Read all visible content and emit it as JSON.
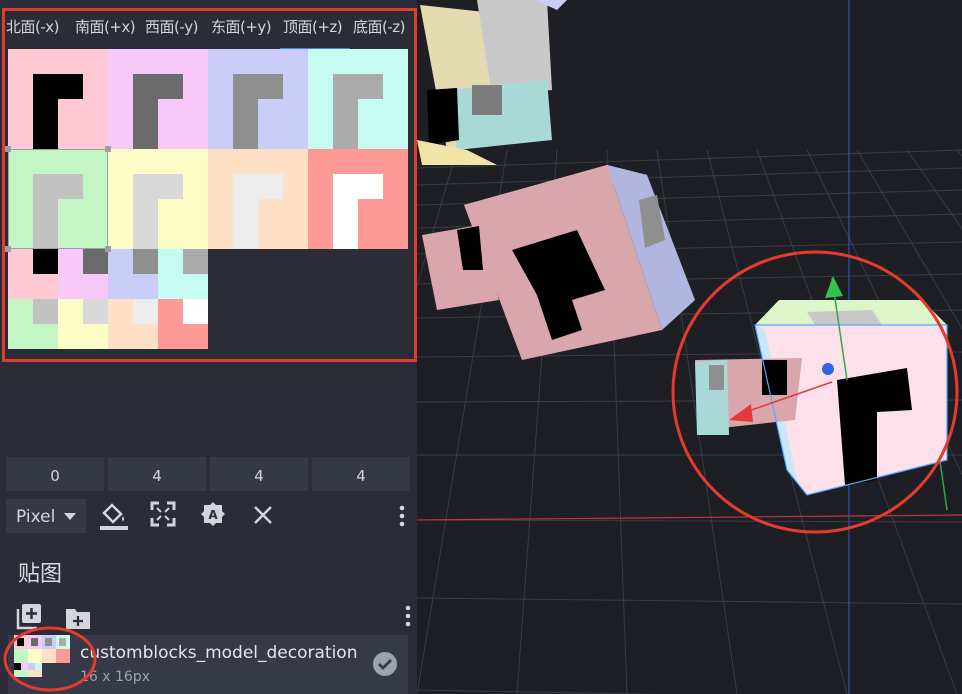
{
  "face_tabs": [
    {
      "label": "北面(-x)"
    },
    {
      "label": "南面(+x)"
    },
    {
      "label": "西面(-y)"
    },
    {
      "label": "东面(+y)"
    },
    {
      "label": "顶面(+z)",
      "active": true
    },
    {
      "label": "底面(-z)"
    }
  ],
  "uv_values": [
    "0",
    "4",
    "4",
    "4"
  ],
  "toolbar": {
    "mode_label": "Pixel"
  },
  "textures": {
    "section_title": "贴图",
    "item": {
      "name": "customblocks_model_decoration",
      "size": "16 x 16px"
    }
  },
  "colors": {
    "accent": "#3a82f7",
    "highlight_red": "#e53b2c",
    "panel_bg": "#2a2d37"
  }
}
